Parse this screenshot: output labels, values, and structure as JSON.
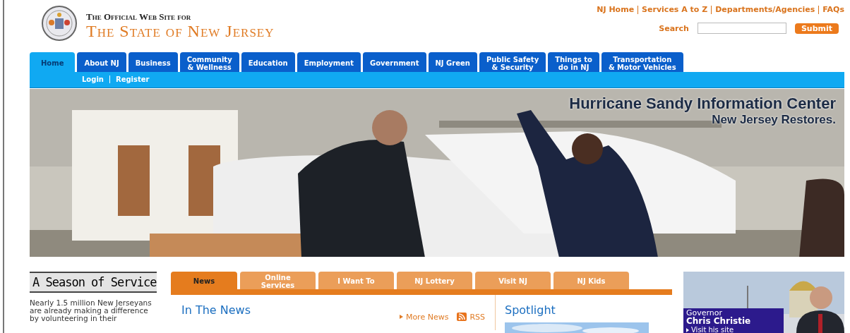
{
  "header": {
    "tagline": "The Official Web Site for",
    "title": "The State of New Jersey"
  },
  "top_links": [
    "NJ Home",
    "Services A to Z",
    "Departments/Agencies",
    "FAQs"
  ],
  "search": {
    "label": "Search",
    "button": "Submit"
  },
  "nav_tabs": [
    {
      "label": "Home",
      "selected": true
    },
    {
      "label": "About NJ",
      "selected": false
    },
    {
      "label": "Business",
      "selected": false
    },
    {
      "label": "Community\n& Wellness",
      "selected": false
    },
    {
      "label": "Education",
      "selected": false
    },
    {
      "label": "Employment",
      "selected": false
    },
    {
      "label": "Government",
      "selected": false
    },
    {
      "label": "NJ Green",
      "selected": false
    },
    {
      "label": "Public Safety\n& Security",
      "selected": false
    },
    {
      "label": "Things to\ndo in NJ",
      "selected": false
    },
    {
      "label": "Transportation\n& Motor Vehicles",
      "selected": false
    }
  ],
  "sub_links": [
    "Login",
    "Register"
  ],
  "hero": {
    "kind": "picture",
    "headline": "Hurricane Sandy Information Center",
    "subhead": "New Jersey Restores."
  },
  "season": {
    "title": "A Season of Service",
    "text": "Nearly 1.5 million New Jerseyans are already making a difference by volunteering in their"
  },
  "content_tabs": [
    {
      "label": "News",
      "selected": true
    },
    {
      "label": "Online\nServices",
      "selected": false
    },
    {
      "label": "I Want To",
      "selected": false
    },
    {
      "label": "NJ Lottery",
      "selected": false
    },
    {
      "label": "Visit NJ",
      "selected": false
    },
    {
      "label": "NJ Kids",
      "selected": false
    }
  ],
  "news": {
    "heading": "In The News",
    "more": "More News",
    "rss": "RSS"
  },
  "spotlight": {
    "heading": "Spotlight",
    "kind": "picture"
  },
  "governor": {
    "kind": "picture",
    "title": "Governor",
    "name": "Chris Christie",
    "link": "Visit his site"
  }
}
